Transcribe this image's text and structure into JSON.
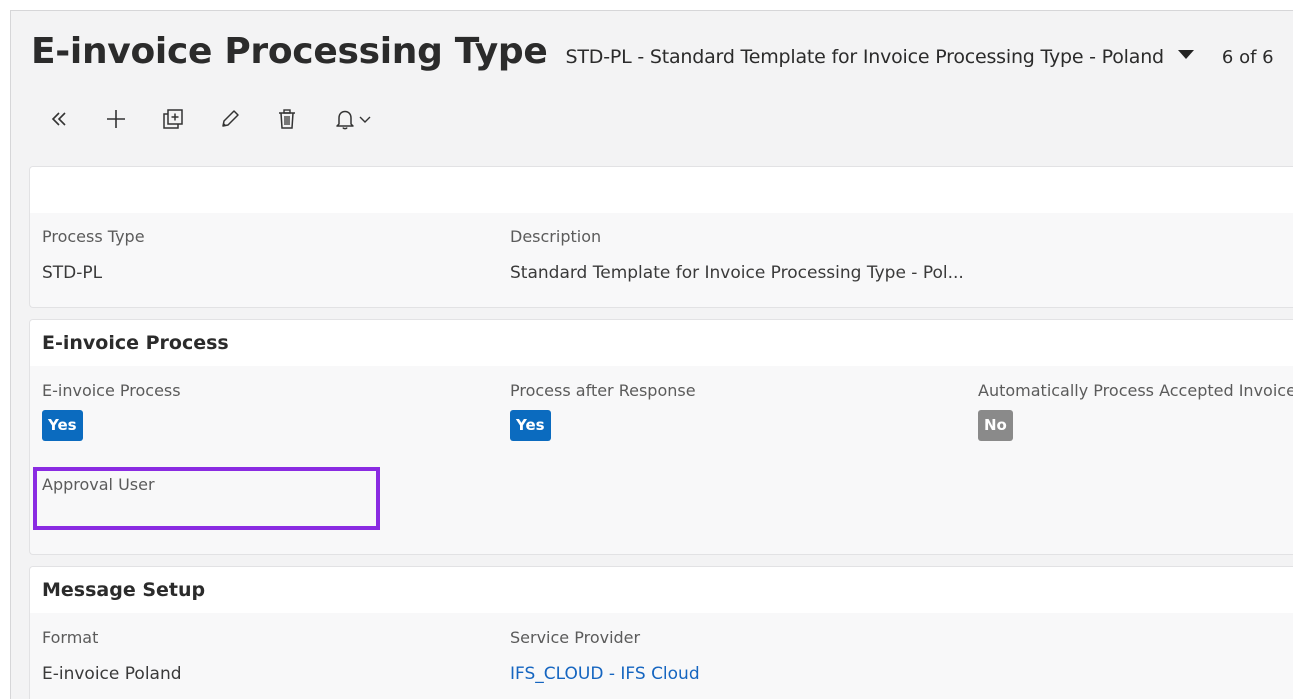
{
  "header": {
    "title": "E-invoice Processing Type",
    "record_name": "STD-PL - Standard Template for Invoice Processing Type - Poland",
    "record_count": "6 of 6"
  },
  "toolbar": {
    "buttons": [
      {
        "name": "collapse",
        "icon": "double-chevron-left-icon"
      },
      {
        "name": "new",
        "icon": "plus-icon"
      },
      {
        "name": "duplicate",
        "icon": "duplicate-icon"
      },
      {
        "name": "edit",
        "icon": "pencil-icon"
      },
      {
        "name": "delete",
        "icon": "trash-icon"
      },
      {
        "name": "notifications",
        "icon": "bell-icon"
      }
    ]
  },
  "general_card": {
    "fields": [
      {
        "label": "Process Type",
        "value": "STD-PL"
      },
      {
        "label": "Description",
        "value": "Standard Template for Invoice Processing Type - Pol..."
      }
    ]
  },
  "einvoice_card": {
    "title": "E-invoice Process",
    "fields": [
      {
        "label": "E-invoice Process",
        "value": "Yes"
      },
      {
        "label": "Process after Response",
        "value": "Yes"
      },
      {
        "label": "Automatically Process Accepted Invoice",
        "value": "No"
      },
      {
        "label": "Approval User",
        "value": ""
      }
    ]
  },
  "message_card": {
    "title": "Message Setup",
    "fields": [
      {
        "label": "Format",
        "value": "E-invoice Poland"
      },
      {
        "label": "Service Provider",
        "value": "IFS_CLOUD - IFS Cloud"
      }
    ]
  },
  "colors": {
    "badge_yes": "#0b6bbf",
    "badge_no": "#8a8a8a",
    "link": "#1565c0",
    "highlight": "#8a2be2"
  }
}
